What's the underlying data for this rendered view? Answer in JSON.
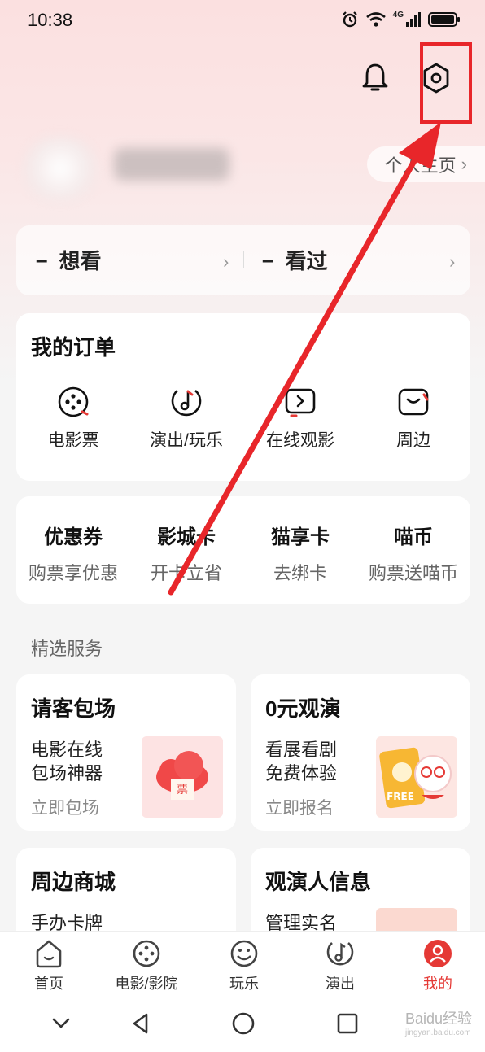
{
  "status": {
    "time": "10:38",
    "network": "4G"
  },
  "profile": {
    "homepage_label": "个人主页"
  },
  "watch": {
    "want_label": "想看",
    "want_count": "–",
    "seen_label": "看过",
    "seen_count": "–"
  },
  "orders": {
    "title": "我的订单",
    "items": [
      {
        "label": "电影票",
        "icon": "film-reel-icon"
      },
      {
        "label": "演出/玩乐",
        "icon": "music-note-icon"
      },
      {
        "label": "在线观影",
        "icon": "play-screen-icon"
      },
      {
        "label": "周边",
        "icon": "bag-icon"
      }
    ]
  },
  "benefits": [
    {
      "title": "优惠券",
      "sub": "购票享优惠"
    },
    {
      "title": "影城卡",
      "sub": "开卡立省"
    },
    {
      "title": "猫享卡",
      "sub": "去绑卡"
    },
    {
      "title": "喵币",
      "sub": "购票送喵币"
    }
  ],
  "services_label": "精选服务",
  "services": [
    {
      "title": "请客包场",
      "desc_line1": "电影在线",
      "desc_line2": "包场神器",
      "link": "立即包场",
      "image_text": "票"
    },
    {
      "title": "0元观演",
      "desc_line1": "看展看剧",
      "desc_line2": "免费体验",
      "link": "立即报名",
      "image_text": "FREE"
    },
    {
      "title": "周边商城",
      "desc_line1": "手办卡牌"
    },
    {
      "title": "观演人信息",
      "desc_line1": "管理实名"
    }
  ],
  "tabs": [
    {
      "label": "首页",
      "icon": "home-icon"
    },
    {
      "label": "电影/影院",
      "icon": "film-reel-icon"
    },
    {
      "label": "玩乐",
      "icon": "smiley-icon"
    },
    {
      "label": "演出",
      "icon": "music-note-icon"
    },
    {
      "label": "我的",
      "icon": "user-icon"
    }
  ],
  "watermark": {
    "brand": "Baidu经验",
    "url": "jingyan.baidu.com"
  },
  "colors": {
    "accent": "#e53935",
    "highlight": "#e8262a"
  }
}
